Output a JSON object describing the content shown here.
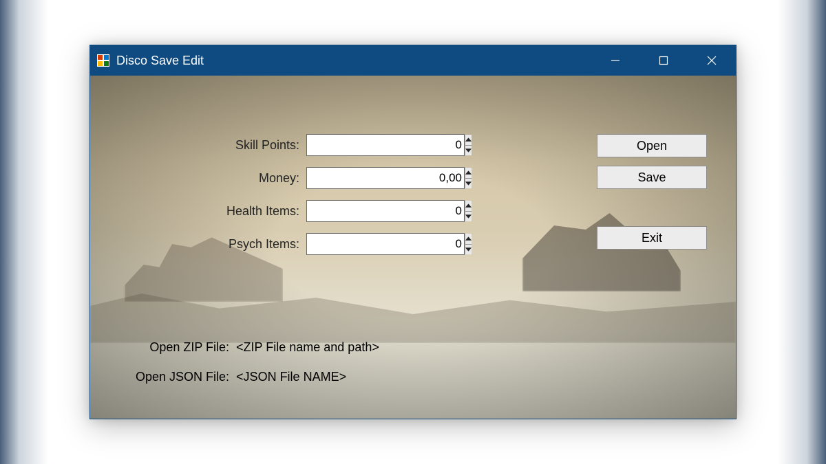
{
  "window": {
    "title": "Disco Save Edit"
  },
  "fields": {
    "skill_points": {
      "label": "Skill Points:",
      "value": "0"
    },
    "money": {
      "label": "Money:",
      "value": "0,00"
    },
    "health_items": {
      "label": "Health Items:",
      "value": "0"
    },
    "psych_items": {
      "label": "Psych Items:",
      "value": "0"
    }
  },
  "buttons": {
    "open": "Open",
    "save": "Save",
    "exit": "Exit"
  },
  "file_info": {
    "zip_label": "Open ZIP File:",
    "zip_value": "<ZIP File name and path>",
    "json_label": "Open JSON File:",
    "json_value": "<JSON File NAME>"
  }
}
